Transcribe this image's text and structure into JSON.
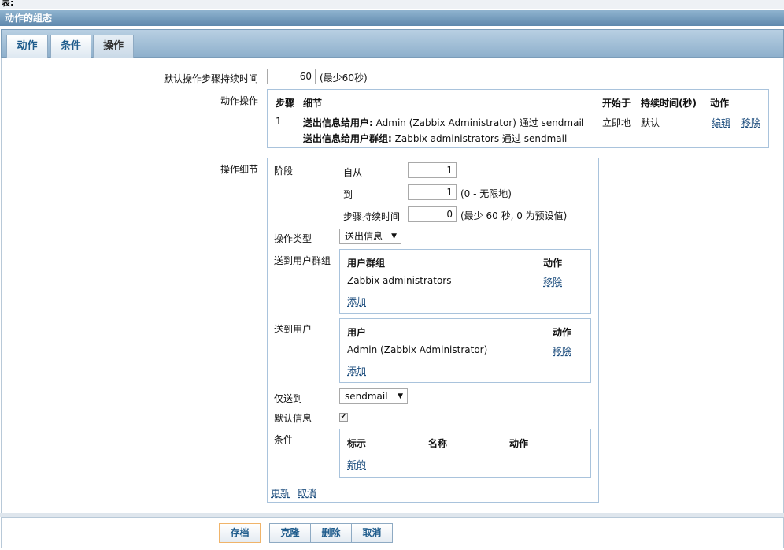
{
  "top_fragment": "表:",
  "title": "动作的组态",
  "tabs": [
    {
      "label": "动作"
    },
    {
      "label": "条件"
    },
    {
      "label": "操作"
    }
  ],
  "default_step_duration": {
    "label": "默认操作步骤持续时间",
    "value": "60",
    "hint": "(最少60秒)"
  },
  "action_operations": {
    "label": "动作操作",
    "headers": {
      "step": "步骤",
      "detail": "细节",
      "start_in": "开始于",
      "duration": "持续时间(秒)",
      "action": "动作"
    },
    "row": {
      "step": "1",
      "line1_bold": "送出信息给用户:",
      "line1_rest": "Admin (Zabbix Administrator) 通过 sendmail",
      "line2_bold": "送出信息给用户群组:",
      "line2_rest": "Zabbix administrators 通过 sendmail",
      "start_in": "立即地",
      "duration": "默认",
      "edit": "编辑",
      "remove": "移除"
    }
  },
  "operation_details": {
    "label": "操作细节",
    "stage_label": "阶段",
    "from_label": "自从",
    "from_value": "1",
    "to_label": "到",
    "to_value": "1",
    "to_hint": "(0 - 无限地)",
    "step_duration_label": "步骤持续时间",
    "step_duration_value": "0",
    "step_duration_hint": "(最少 60 秒, 0 为预设值)",
    "op_type_label": "操作类型",
    "op_type_value": "送出信息",
    "send_to_groups_label": "送到用户群组",
    "groups_table": {
      "col1": "用户群组",
      "col2": "动作",
      "row_name": "Zabbix administrators",
      "row_action": "移除",
      "add": "添加"
    },
    "send_to_users_label": "送到用户",
    "users_table": {
      "col1": "用户",
      "col2": "动作",
      "row_name": "Admin (Zabbix Administrator)",
      "row_action": "移除",
      "add": "添加"
    },
    "send_only_to_label": "仅送到",
    "send_only_to_value": "sendmail",
    "default_message_label": "默认信息",
    "conditions_label": "条件",
    "conditions_table": {
      "col1": "标示",
      "col2": "名称",
      "col3": "动作",
      "new": "新的"
    },
    "update": "更新",
    "cancel": "取消"
  },
  "footer": {
    "save": "存档",
    "clone": "克隆",
    "delete": "删除",
    "cancel": "取消"
  }
}
